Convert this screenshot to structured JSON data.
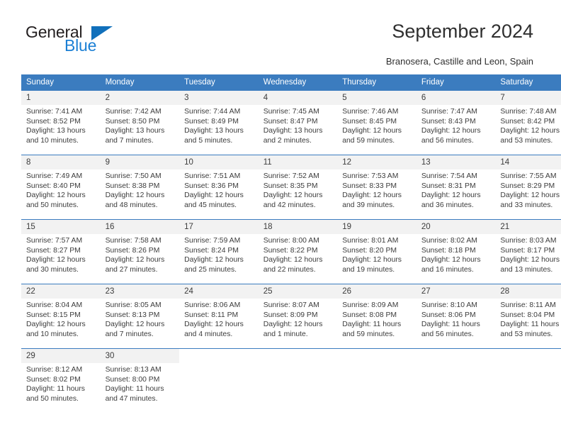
{
  "brand": {
    "name_part1": "General",
    "name_part2": "Blue",
    "triangle_icon": "triangle-icon"
  },
  "header": {
    "title": "September 2024",
    "location": "Branosera, Castille and Leon, Spain"
  },
  "colors": {
    "header_blue": "#3b7cbf",
    "daynum_band": "#f2f2f2",
    "brand_blue": "#1b7fd4",
    "text": "#3c3c3c"
  },
  "calendar": {
    "weekday_headers": [
      "Sunday",
      "Monday",
      "Tuesday",
      "Wednesday",
      "Thursday",
      "Friday",
      "Saturday"
    ],
    "weeks": [
      [
        {
          "day": "1",
          "sunrise": "Sunrise: 7:41 AM",
          "sunset": "Sunset: 8:52 PM",
          "daylight1": "Daylight: 13 hours",
          "daylight2": "and 10 minutes."
        },
        {
          "day": "2",
          "sunrise": "Sunrise: 7:42 AM",
          "sunset": "Sunset: 8:50 PM",
          "daylight1": "Daylight: 13 hours",
          "daylight2": "and 7 minutes."
        },
        {
          "day": "3",
          "sunrise": "Sunrise: 7:44 AM",
          "sunset": "Sunset: 8:49 PM",
          "daylight1": "Daylight: 13 hours",
          "daylight2": "and 5 minutes."
        },
        {
          "day": "4",
          "sunrise": "Sunrise: 7:45 AM",
          "sunset": "Sunset: 8:47 PM",
          "daylight1": "Daylight: 13 hours",
          "daylight2": "and 2 minutes."
        },
        {
          "day": "5",
          "sunrise": "Sunrise: 7:46 AM",
          "sunset": "Sunset: 8:45 PM",
          "daylight1": "Daylight: 12 hours",
          "daylight2": "and 59 minutes."
        },
        {
          "day": "6",
          "sunrise": "Sunrise: 7:47 AM",
          "sunset": "Sunset: 8:43 PM",
          "daylight1": "Daylight: 12 hours",
          "daylight2": "and 56 minutes."
        },
        {
          "day": "7",
          "sunrise": "Sunrise: 7:48 AM",
          "sunset": "Sunset: 8:42 PM",
          "daylight1": "Daylight: 12 hours",
          "daylight2": "and 53 minutes."
        }
      ],
      [
        {
          "day": "8",
          "sunrise": "Sunrise: 7:49 AM",
          "sunset": "Sunset: 8:40 PM",
          "daylight1": "Daylight: 12 hours",
          "daylight2": "and 50 minutes."
        },
        {
          "day": "9",
          "sunrise": "Sunrise: 7:50 AM",
          "sunset": "Sunset: 8:38 PM",
          "daylight1": "Daylight: 12 hours",
          "daylight2": "and 48 minutes."
        },
        {
          "day": "10",
          "sunrise": "Sunrise: 7:51 AM",
          "sunset": "Sunset: 8:36 PM",
          "daylight1": "Daylight: 12 hours",
          "daylight2": "and 45 minutes."
        },
        {
          "day": "11",
          "sunrise": "Sunrise: 7:52 AM",
          "sunset": "Sunset: 8:35 PM",
          "daylight1": "Daylight: 12 hours",
          "daylight2": "and 42 minutes."
        },
        {
          "day": "12",
          "sunrise": "Sunrise: 7:53 AM",
          "sunset": "Sunset: 8:33 PM",
          "daylight1": "Daylight: 12 hours",
          "daylight2": "and 39 minutes."
        },
        {
          "day": "13",
          "sunrise": "Sunrise: 7:54 AM",
          "sunset": "Sunset: 8:31 PM",
          "daylight1": "Daylight: 12 hours",
          "daylight2": "and 36 minutes."
        },
        {
          "day": "14",
          "sunrise": "Sunrise: 7:55 AM",
          "sunset": "Sunset: 8:29 PM",
          "daylight1": "Daylight: 12 hours",
          "daylight2": "and 33 minutes."
        }
      ],
      [
        {
          "day": "15",
          "sunrise": "Sunrise: 7:57 AM",
          "sunset": "Sunset: 8:27 PM",
          "daylight1": "Daylight: 12 hours",
          "daylight2": "and 30 minutes."
        },
        {
          "day": "16",
          "sunrise": "Sunrise: 7:58 AM",
          "sunset": "Sunset: 8:26 PM",
          "daylight1": "Daylight: 12 hours",
          "daylight2": "and 27 minutes."
        },
        {
          "day": "17",
          "sunrise": "Sunrise: 7:59 AM",
          "sunset": "Sunset: 8:24 PM",
          "daylight1": "Daylight: 12 hours",
          "daylight2": "and 25 minutes."
        },
        {
          "day": "18",
          "sunrise": "Sunrise: 8:00 AM",
          "sunset": "Sunset: 8:22 PM",
          "daylight1": "Daylight: 12 hours",
          "daylight2": "and 22 minutes."
        },
        {
          "day": "19",
          "sunrise": "Sunrise: 8:01 AM",
          "sunset": "Sunset: 8:20 PM",
          "daylight1": "Daylight: 12 hours",
          "daylight2": "and 19 minutes."
        },
        {
          "day": "20",
          "sunrise": "Sunrise: 8:02 AM",
          "sunset": "Sunset: 8:18 PM",
          "daylight1": "Daylight: 12 hours",
          "daylight2": "and 16 minutes."
        },
        {
          "day": "21",
          "sunrise": "Sunrise: 8:03 AM",
          "sunset": "Sunset: 8:17 PM",
          "daylight1": "Daylight: 12 hours",
          "daylight2": "and 13 minutes."
        }
      ],
      [
        {
          "day": "22",
          "sunrise": "Sunrise: 8:04 AM",
          "sunset": "Sunset: 8:15 PM",
          "daylight1": "Daylight: 12 hours",
          "daylight2": "and 10 minutes."
        },
        {
          "day": "23",
          "sunrise": "Sunrise: 8:05 AM",
          "sunset": "Sunset: 8:13 PM",
          "daylight1": "Daylight: 12 hours",
          "daylight2": "and 7 minutes."
        },
        {
          "day": "24",
          "sunrise": "Sunrise: 8:06 AM",
          "sunset": "Sunset: 8:11 PM",
          "daylight1": "Daylight: 12 hours",
          "daylight2": "and 4 minutes."
        },
        {
          "day": "25",
          "sunrise": "Sunrise: 8:07 AM",
          "sunset": "Sunset: 8:09 PM",
          "daylight1": "Daylight: 12 hours",
          "daylight2": "and 1 minute."
        },
        {
          "day": "26",
          "sunrise": "Sunrise: 8:09 AM",
          "sunset": "Sunset: 8:08 PM",
          "daylight1": "Daylight: 11 hours",
          "daylight2": "and 59 minutes."
        },
        {
          "day": "27",
          "sunrise": "Sunrise: 8:10 AM",
          "sunset": "Sunset: 8:06 PM",
          "daylight1": "Daylight: 11 hours",
          "daylight2": "and 56 minutes."
        },
        {
          "day": "28",
          "sunrise": "Sunrise: 8:11 AM",
          "sunset": "Sunset: 8:04 PM",
          "daylight1": "Daylight: 11 hours",
          "daylight2": "and 53 minutes."
        }
      ],
      [
        {
          "day": "29",
          "sunrise": "Sunrise: 8:12 AM",
          "sunset": "Sunset: 8:02 PM",
          "daylight1": "Daylight: 11 hours",
          "daylight2": "and 50 minutes."
        },
        {
          "day": "30",
          "sunrise": "Sunrise: 8:13 AM",
          "sunset": "Sunset: 8:00 PM",
          "daylight1": "Daylight: 11 hours",
          "daylight2": "and 47 minutes."
        },
        {
          "day": "",
          "sunrise": "",
          "sunset": "",
          "daylight1": "",
          "daylight2": ""
        },
        {
          "day": "",
          "sunrise": "",
          "sunset": "",
          "daylight1": "",
          "daylight2": ""
        },
        {
          "day": "",
          "sunrise": "",
          "sunset": "",
          "daylight1": "",
          "daylight2": ""
        },
        {
          "day": "",
          "sunrise": "",
          "sunset": "",
          "daylight1": "",
          "daylight2": ""
        },
        {
          "day": "",
          "sunrise": "",
          "sunset": "",
          "daylight1": "",
          "daylight2": ""
        }
      ]
    ]
  }
}
